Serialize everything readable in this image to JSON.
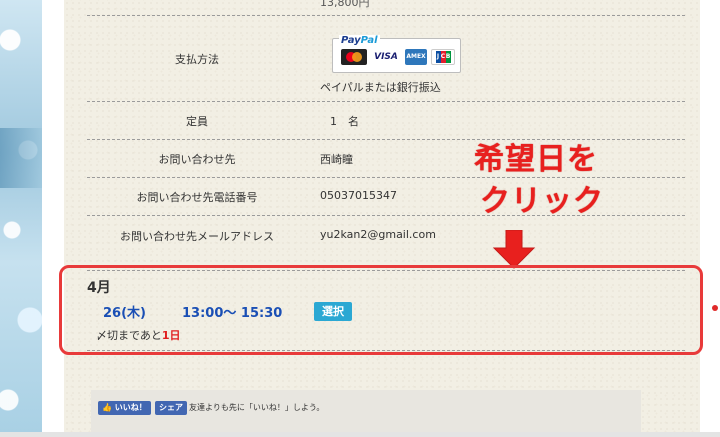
{
  "price_partial": "13,800円",
  "rows": {
    "payment": {
      "label": "支払方法",
      "value": "ペイパルまたは銀行振込"
    },
    "capacity": {
      "label": "定員",
      "value": "1　名"
    },
    "contact": {
      "label": "お問い合わせ先",
      "value": "西崎瞳"
    },
    "phone": {
      "label": "お問い合わせ先電話番号",
      "value": "05037015347"
    },
    "email": {
      "label": "お問い合わせ先メールアドレス",
      "value": "yu2kan2@gmail.com"
    }
  },
  "paypal": {
    "brand_pay": "Pay",
    "brand_pal": "Pal",
    "visa": "VISA",
    "amex": "AMEX"
  },
  "annotation": {
    "line1": "希望日を",
    "line2": "クリック",
    "color": "#e8201e"
  },
  "schedule": {
    "month": "4月",
    "date": "26(木)",
    "time": "13:00～ 15:30",
    "select_label": "選択",
    "deadline_prefix": "〆切まであと",
    "deadline_value": "1日"
  },
  "facebook": {
    "like_label": "いいね！",
    "share_label": "シェア",
    "text": "友達よりも先に「いいね！」しよう。"
  },
  "colors": {
    "accent_red": "#e83a3a",
    "link_blue": "#1a4fb5",
    "button_blue": "#2ba8d3",
    "facebook_blue": "#4267b2"
  }
}
